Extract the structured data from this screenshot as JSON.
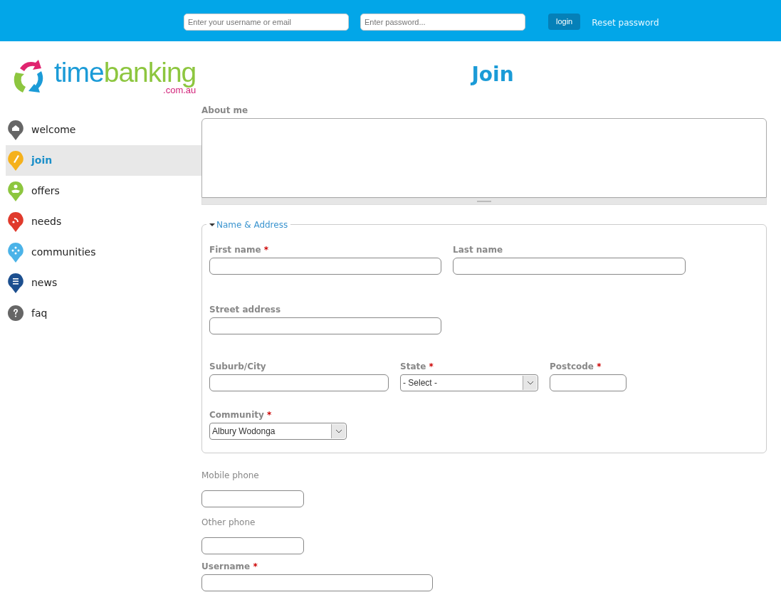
{
  "top_bar": {
    "username": {
      "placeholder": "Enter your username or email"
    },
    "password": {
      "placeholder": "Enter password..."
    },
    "login_button": "login",
    "reset_link": "Reset password"
  },
  "logo": {
    "parts": [
      {
        "text": "time",
        "color": "#1b9bd7"
      },
      {
        "text": "banking",
        "color": "#8dc63f"
      }
    ],
    "domain": ".com.au"
  },
  "sidebar": {
    "items": [
      {
        "label": "welcome",
        "selected": false,
        "color": "#666666"
      },
      {
        "label": "join",
        "selected": true,
        "color": "#f5b11c"
      },
      {
        "label": "offers",
        "selected": false,
        "color": "#8dc63f"
      },
      {
        "label": "needs",
        "selected": false,
        "color": "#e03a2c"
      },
      {
        "label": "communities",
        "selected": false,
        "color": "#4bb3e8"
      },
      {
        "label": "news",
        "selected": false,
        "color": "#1c4f8f"
      },
      {
        "label": "faq",
        "selected": false,
        "color": "#666666"
      }
    ]
  },
  "title": "Join",
  "about": {
    "label": "About me"
  },
  "fieldset": {
    "legend": "Name & Address",
    "expanded": true,
    "rows": [
      [
        {
          "label": "First name",
          "marker": "*",
          "kind": "text"
        },
        {
          "label": "Last name",
          "kind": "text"
        }
      ],
      [
        {
          "label": "Street address",
          "kind": "text"
        }
      ],
      [
        {
          "label": "Suburb/City",
          "kind": "text"
        },
        {
          "label": "State",
          "marker": "*",
          "kind": "select",
          "value": "- Select -"
        },
        {
          "label": "Postcode",
          "marker": "*",
          "kind": "text"
        }
      ],
      [
        {
          "label": "Community",
          "marker": "*",
          "kind": "select",
          "value": "Albury Wodonga"
        }
      ]
    ]
  },
  "fields": [
    {
      "label": "Mobile phone",
      "bold": false,
      "kind": "text"
    },
    {
      "label": "Other phone",
      "bold": false,
      "kind": "text"
    },
    {
      "label": "Username",
      "bold": true,
      "marker": "*",
      "kind": "text"
    }
  ]
}
